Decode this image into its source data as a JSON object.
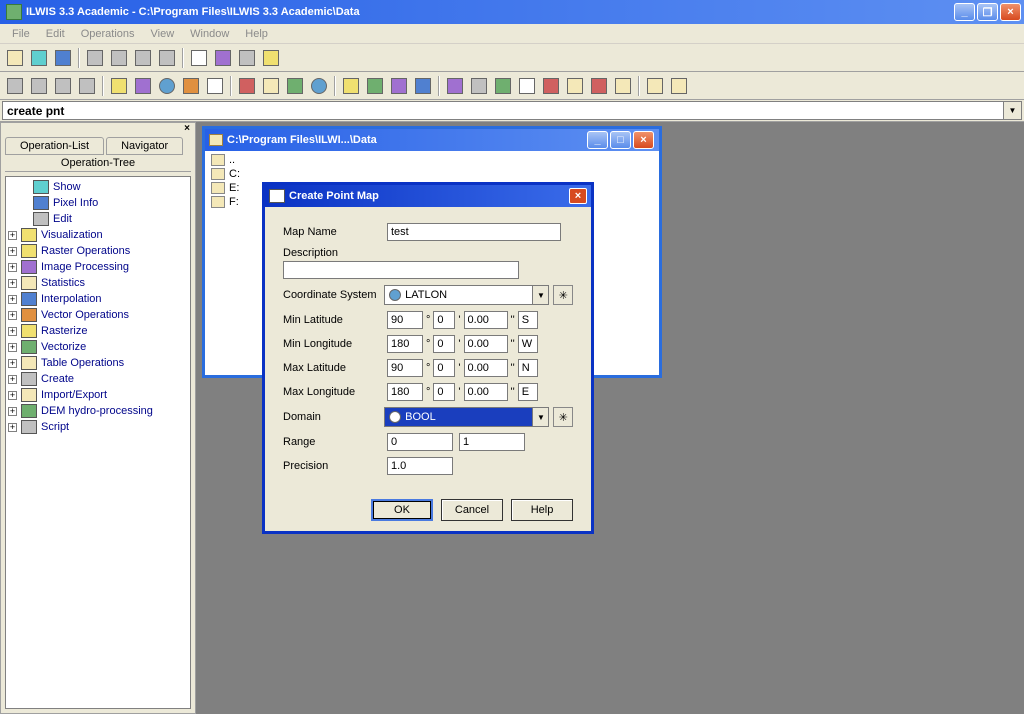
{
  "title": "ILWIS 3.3 Academic - C:\\Program Files\\ILWIS 3.3 Academic\\Data",
  "menus": [
    "File",
    "Edit",
    "Operations",
    "View",
    "Window",
    "Help"
  ],
  "command": "create pnt",
  "sidebar": {
    "tabs": [
      "Operation-List",
      "Navigator"
    ],
    "tab2": "Operation-Tree",
    "items": [
      {
        "label": "Show",
        "exp": false
      },
      {
        "label": "Pixel Info",
        "exp": false
      },
      {
        "label": "Edit",
        "exp": false
      },
      {
        "label": "Visualization",
        "exp": true
      },
      {
        "label": "Raster Operations",
        "exp": true
      },
      {
        "label": "Image Processing",
        "exp": true
      },
      {
        "label": "Statistics",
        "exp": true
      },
      {
        "label": "Interpolation",
        "exp": true
      },
      {
        "label": "Vector Operations",
        "exp": true
      },
      {
        "label": "Rasterize",
        "exp": true
      },
      {
        "label": "Vectorize",
        "exp": true
      },
      {
        "label": "Table Operations",
        "exp": true
      },
      {
        "label": "Create",
        "exp": true
      },
      {
        "label": "Import/Export",
        "exp": true
      },
      {
        "label": "DEM hydro-processing",
        "exp": true
      },
      {
        "label": "Script",
        "exp": true
      }
    ]
  },
  "child_window": {
    "title": "C:\\Program Files\\ILWI...\\Data",
    "entries": [
      "..",
      "C:",
      "E:",
      "F:"
    ]
  },
  "dialog": {
    "title": "Create Point Map",
    "labels": {
      "map_name": "Map Name",
      "description": "Description",
      "coordsys": "Coordinate System",
      "minlat": "Min Latitude",
      "minlon": "Min Longitude",
      "maxlat": "Max Latitude",
      "maxlon": "Max Longitude",
      "domain": "Domain",
      "range": "Range",
      "precision": "Precision"
    },
    "values": {
      "map_name": "test",
      "description": "",
      "coordsys": "LATLON",
      "minlat_d": "90",
      "minlat_m": "0",
      "minlat_s": "0.00",
      "minlat_h": "S",
      "minlon_d": "180",
      "minlon_m": "0",
      "minlon_s": "0.00",
      "minlon_h": "W",
      "maxlat_d": "90",
      "maxlat_m": "0",
      "maxlat_s": "0.00",
      "maxlat_h": "N",
      "maxlon_d": "180",
      "maxlon_m": "0",
      "maxlon_s": "0.00",
      "maxlon_h": "E",
      "domain": "BOOL",
      "range_from": "0",
      "range_to": "1",
      "precision": "1.0"
    },
    "buttons": {
      "ok": "OK",
      "cancel": "Cancel",
      "help": "Help"
    }
  }
}
